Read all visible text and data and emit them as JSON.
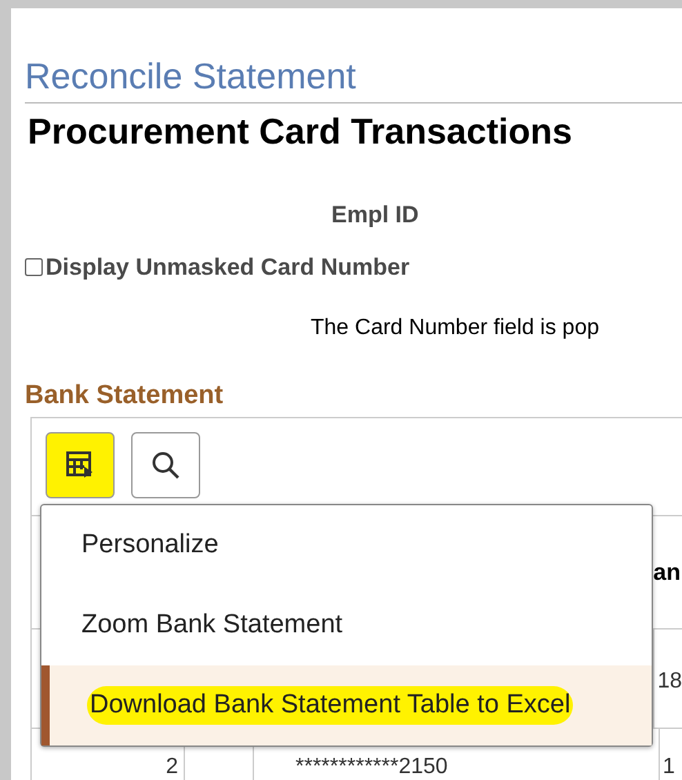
{
  "page_title": "Reconcile Statement",
  "section_title": "Procurement Card Transactions",
  "empl_id": {
    "label": "Empl ID"
  },
  "unmask": {
    "label": "Display Unmasked Card Number",
    "checked": false
  },
  "info_text": "The Card Number field is pop",
  "bank_statement": {
    "title": "Bank Statement",
    "toolbar": [
      {
        "kind": "grid",
        "highlighted": true
      },
      {
        "kind": "search",
        "highlighted": false
      }
    ],
    "column_fragment": "an",
    "rows": [
      {
        "cells": [
          "",
          "",
          "",
          "18"
        ]
      },
      {
        "cells": [
          "2",
          "",
          "************2150",
          "1"
        ]
      }
    ],
    "menu": [
      {
        "label": "Personalize",
        "selected": false,
        "highlighted": false
      },
      {
        "label": "Zoom Bank Statement",
        "selected": false,
        "highlighted": false
      },
      {
        "label": "Download Bank Statement Table to Excel",
        "selected": true,
        "highlighted": true
      }
    ]
  }
}
